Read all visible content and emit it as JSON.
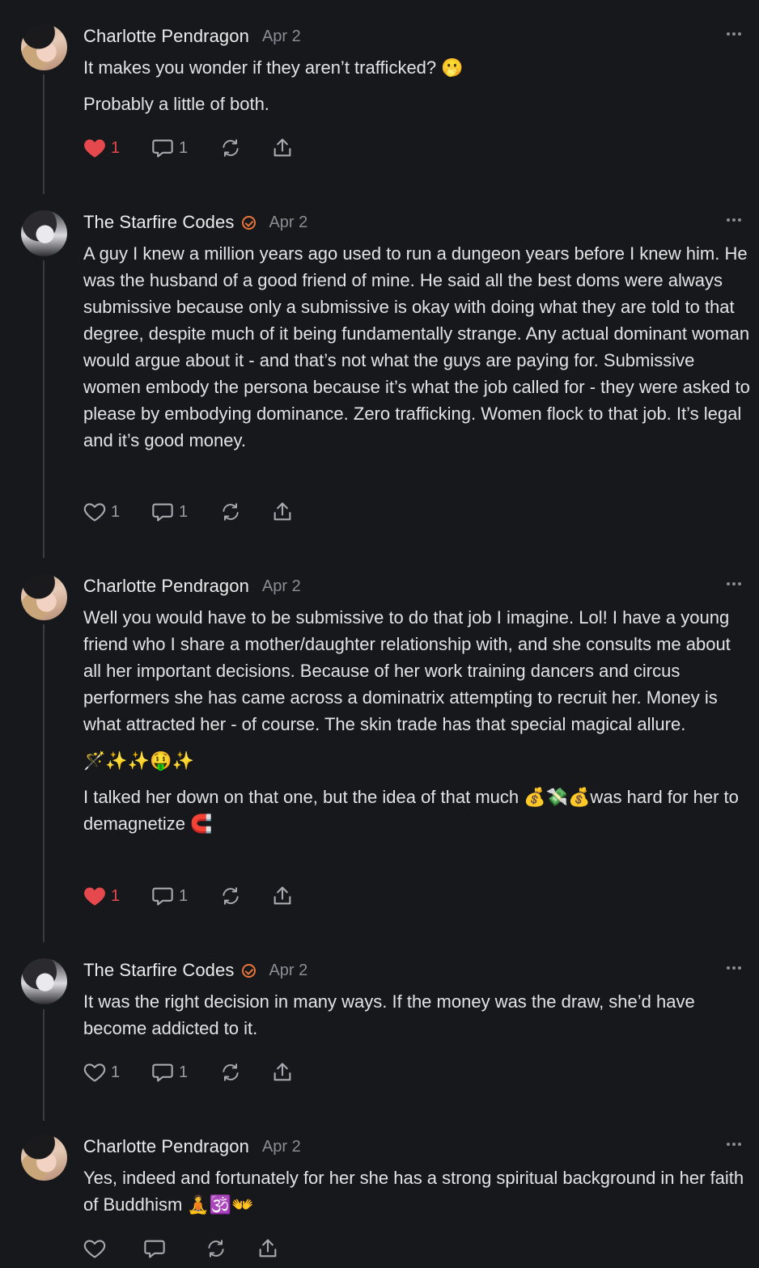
{
  "comments": [
    {
      "author": "Charlotte Pendragon",
      "date": "Apr 2",
      "paragraphs": [
        "It makes you wonder if they aren’t trafficked? 🫢",
        "Probably a little of both."
      ],
      "likes": "1",
      "liked": true,
      "replies": "1"
    },
    {
      "author": "The Starfire Codes",
      "verified": true,
      "date": "Apr 2",
      "paragraphs": [
        "A guy I knew a million years ago used to run a dungeon years before I knew him. He was the husband of a good friend of mine. He said all the best doms were always submissive because only a submissive is okay with doing what they are told to that degree, despite much of it being fundamentally strange. Any actual dominant woman would argue about it - and that’s not what the guys are paying for. Submissive women embody the persona because it’s what the job called for - they were asked to please by embodying dominance. Zero trafficking. Women flock to that job. It’s legal and it’s good money."
      ],
      "likes": "1",
      "liked": false,
      "replies": "1"
    },
    {
      "author": "Charlotte Pendragon",
      "date": "Apr 2",
      "paragraphs": [
        "Well you would have to be submissive to do that job I imagine. Lol! I have a young friend who I share a mother/daughter relationship with, and she consults me about all her important decisions. Because of her work training dancers and circus performers she has came across a dominatrix attempting to recruit her. Money is what attracted her - of course. The skin trade has that special magical allure.",
        "🪄✨✨🤑✨",
        "I talked her down on that one, but the idea of that much 💰💸💰was hard for her to demagnetize 🧲"
      ],
      "likes": "1",
      "liked": true,
      "replies": "1"
    },
    {
      "author": "The Starfire Codes",
      "verified": true,
      "date": "Apr 2",
      "paragraphs": [
        "It was the right decision in many ways. If the money was the draw, she’d have become addicted to it."
      ],
      "likes": "1",
      "liked": false,
      "replies": "1"
    },
    {
      "author": "Charlotte Pendragon",
      "date": "Apr 2",
      "paragraphs": [
        "Yes, indeed and fortunately for her she has a strong spiritual background in her faith of Buddhism 🧘🕉️👐"
      ],
      "likes": "",
      "liked": false,
      "replies": ""
    }
  ],
  "colors": {
    "background": "#17181b",
    "liked": "#e5484d",
    "verified": "#e8743b",
    "muted": "#8c8d93"
  },
  "icons": [
    "heart-icon",
    "comment-icon",
    "restack-icon",
    "share-icon",
    "more-icon",
    "verified-icon"
  ]
}
